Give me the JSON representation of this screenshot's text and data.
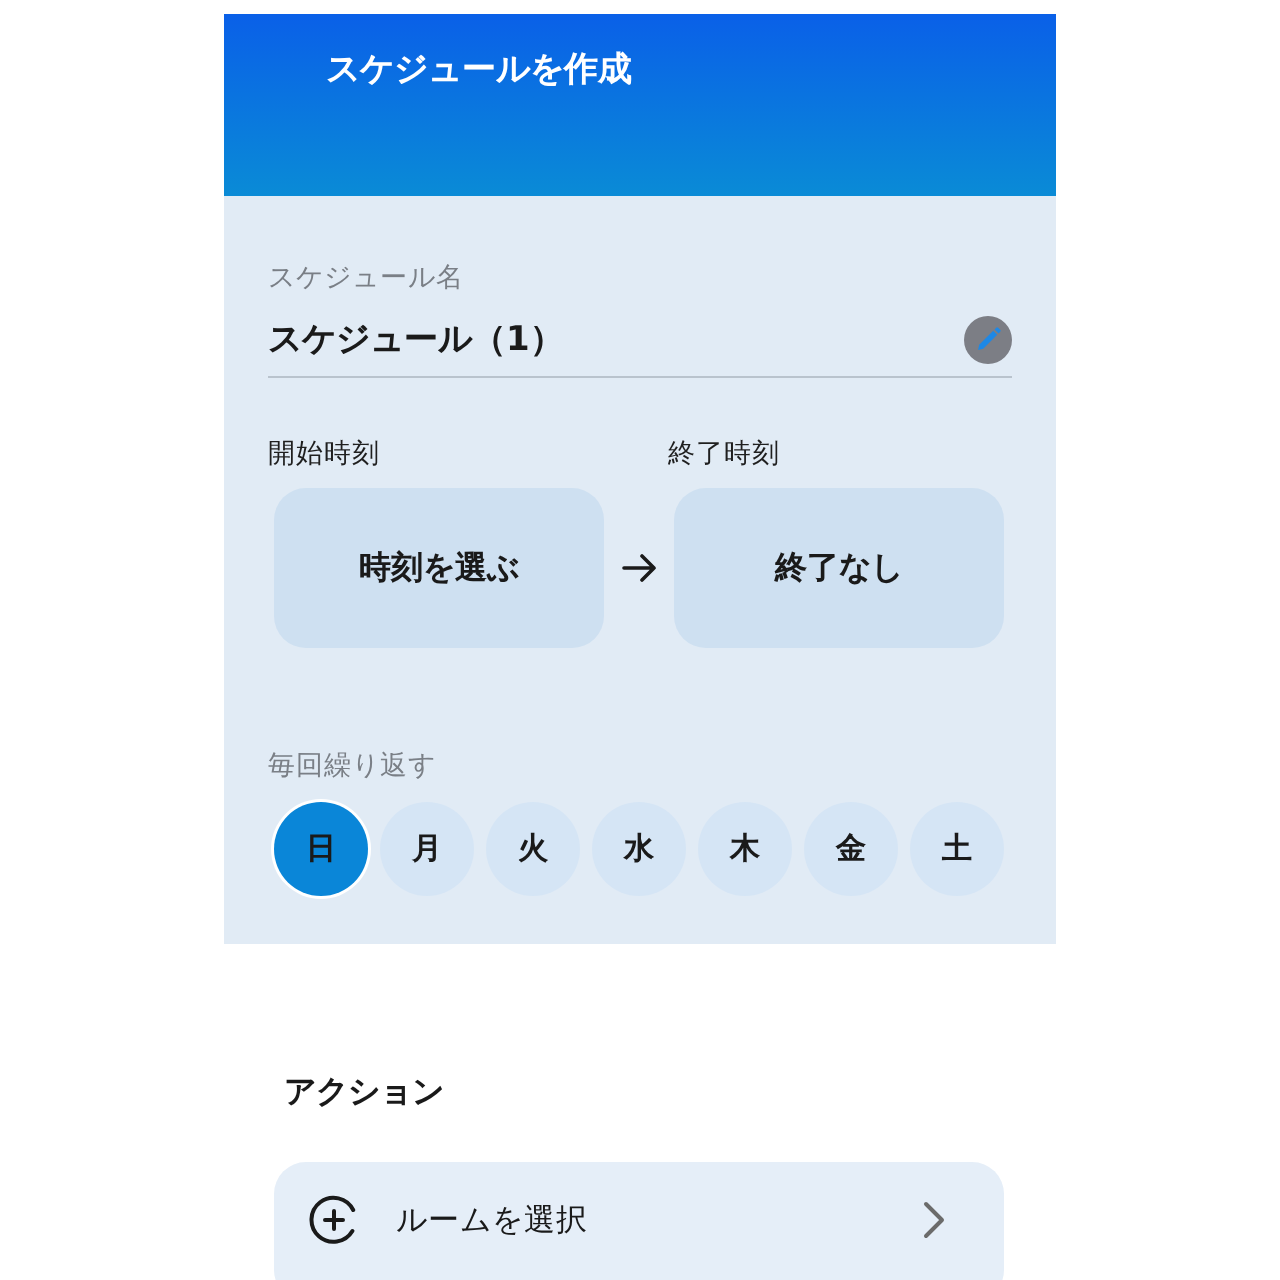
{
  "header": {
    "title": "スケジュールを作成"
  },
  "name_field": {
    "label": "スケジュール名",
    "value": "スケジュール（1）"
  },
  "time": {
    "start": {
      "label": "開始時刻",
      "value": "時刻を選ぶ"
    },
    "end": {
      "label": "終了時刻",
      "value": "終了なし"
    }
  },
  "repeat": {
    "label": "毎回繰り返す",
    "days": [
      {
        "label": "日",
        "selected": true
      },
      {
        "label": "月",
        "selected": false
      },
      {
        "label": "火",
        "selected": false
      },
      {
        "label": "水",
        "selected": false
      },
      {
        "label": "木",
        "selected": false
      },
      {
        "label": "金",
        "selected": false
      },
      {
        "label": "土",
        "selected": false
      }
    ]
  },
  "actions": {
    "title": "アクション",
    "items": [
      {
        "label": "ルームを選択"
      }
    ]
  }
}
